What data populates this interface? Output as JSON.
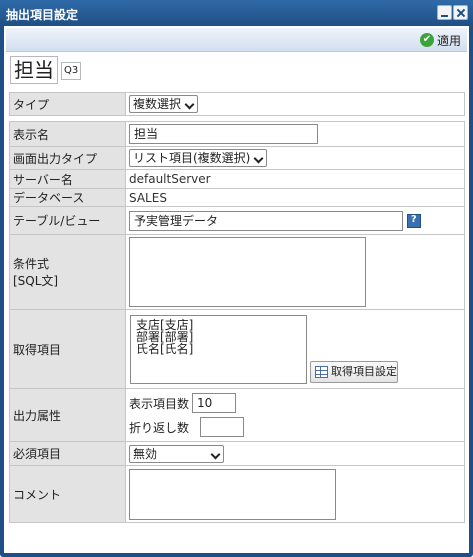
{
  "window": {
    "title": "抽出項目設定"
  },
  "toolbar": {
    "apply_label": "適用"
  },
  "header": {
    "name": "担当",
    "qid": "Q3"
  },
  "type_row": {
    "label": "タイプ",
    "value": "複数選択"
  },
  "fields": {
    "display_name": {
      "label": "表示名",
      "value": "担当"
    },
    "screen_output_type": {
      "label": "画面出力タイプ",
      "value": "リスト項目(複数選択)"
    },
    "server_name": {
      "label": "サーバー名",
      "value": "defaultServer"
    },
    "database": {
      "label": "データベース",
      "value": "SALES"
    },
    "table_view": {
      "label": "テーブル/ビュー",
      "value": "予実管理データ"
    },
    "condition": {
      "label_line1": "条件式",
      "label_line2": "[SQL文]",
      "value": ""
    },
    "fetch_items": {
      "label": "取得項目",
      "items": [
        "支店[支店]",
        "部署[部署]",
        "氏名[氏名]"
      ],
      "button_label": "取得項目設定"
    },
    "output_attr": {
      "label": "出力属性",
      "display_count_label": "表示項目数",
      "display_count_value": "10",
      "wrap_count_label": "折り返し数",
      "wrap_count_value": ""
    },
    "required": {
      "label": "必須項目",
      "value": "無効"
    },
    "comment": {
      "label": "コメント",
      "value": ""
    }
  }
}
